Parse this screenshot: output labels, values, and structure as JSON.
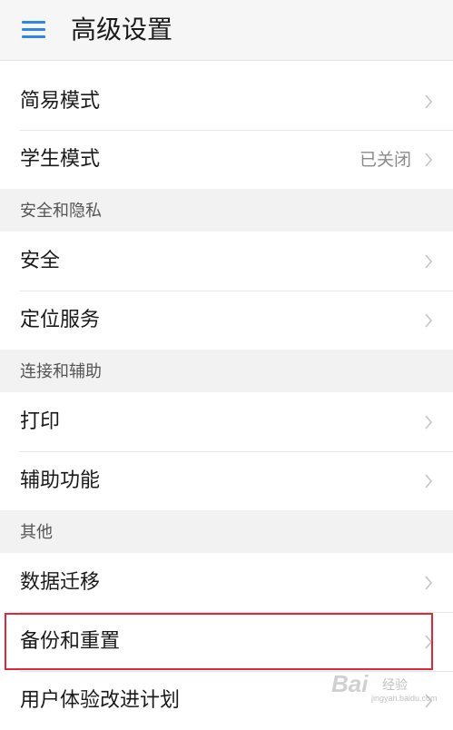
{
  "header": {
    "title": "高级设置",
    "menu_icon": "hamburger-menu-icon",
    "accent_color": "#2f86e6"
  },
  "groups": [
    {
      "items": [
        {
          "label": "简易模式",
          "value": ""
        },
        {
          "label": "学生模式",
          "value": "已关闭"
        }
      ]
    },
    {
      "section": "安全和隐私",
      "items": [
        {
          "label": "安全",
          "value": ""
        },
        {
          "label": "定位服务",
          "value": ""
        }
      ]
    },
    {
      "section": "连接和辅助",
      "items": [
        {
          "label": "打印",
          "value": ""
        },
        {
          "label": "辅助功能",
          "value": ""
        }
      ]
    },
    {
      "section": "其他",
      "items": [
        {
          "label": "数据迁移",
          "value": ""
        },
        {
          "label": "备份和重置",
          "value": "",
          "highlighted": true
        },
        {
          "label": "用户体验改进计划",
          "value": ""
        }
      ]
    }
  ],
  "highlight_color": "#e0283a",
  "watermark": {
    "main": "Bai",
    "sub": "经验",
    "url": "jingyan.baidu.com"
  }
}
